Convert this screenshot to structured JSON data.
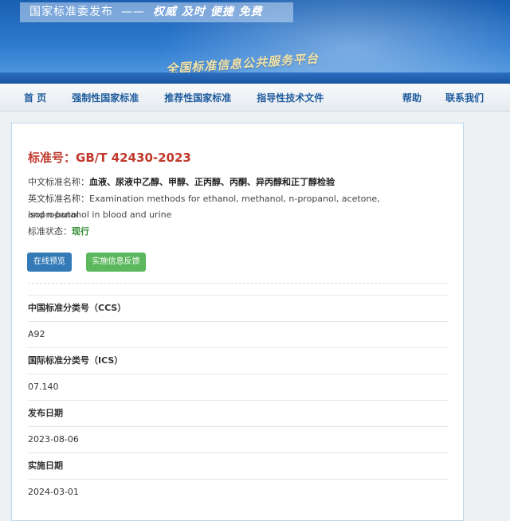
{
  "banner": {
    "slogan_org": "国家标准委发布",
    "slogan_sep": "——",
    "slogan_values": "权威 及时 便捷 免费",
    "platform_name": "全国标准信息公共服务平台"
  },
  "nav": {
    "home": "首 页",
    "mandatory": "强制性国家标准",
    "recommended": "推荐性国家标准",
    "guidance": "指导性技术文件",
    "help": "帮助",
    "contact": "联系我们"
  },
  "standard": {
    "number_label": "标准号：",
    "number": "GB/T 42430-2023",
    "cn_name_label": "中文标准名称：",
    "cn_name": "血液、尿液中乙醇、甲醇、正丙醇、丙酮、异丙醇和正丁醇检验",
    "en_name_label": "英文标准名称：",
    "en_name_line1": "Examination methods for ethanol, methanol, n-propanol, acetone, isopropanol",
    "en_name_line2": "and n-butanol in blood and urine",
    "status_label": "标准状态：",
    "status": "现行"
  },
  "buttons": {
    "preview": "在线预览",
    "feedback": "实施信息反馈"
  },
  "details": {
    "ccs_label": "中国标准分类号（CCS）",
    "ccs": "A92",
    "ics_label": "国际标准分类号（ICS）",
    "ics": "07.140",
    "publish_label": "发布日期",
    "publish": "2023-08-06",
    "implement_label": "实施日期",
    "implement": "2024-03-01"
  },
  "colors": {
    "title_red": "#c0392b",
    "status_green": "#2e8b2e",
    "preview_blue": "#337ab7",
    "feedback_green": "#5cb85c",
    "nav_text": "#1f5c9e"
  }
}
